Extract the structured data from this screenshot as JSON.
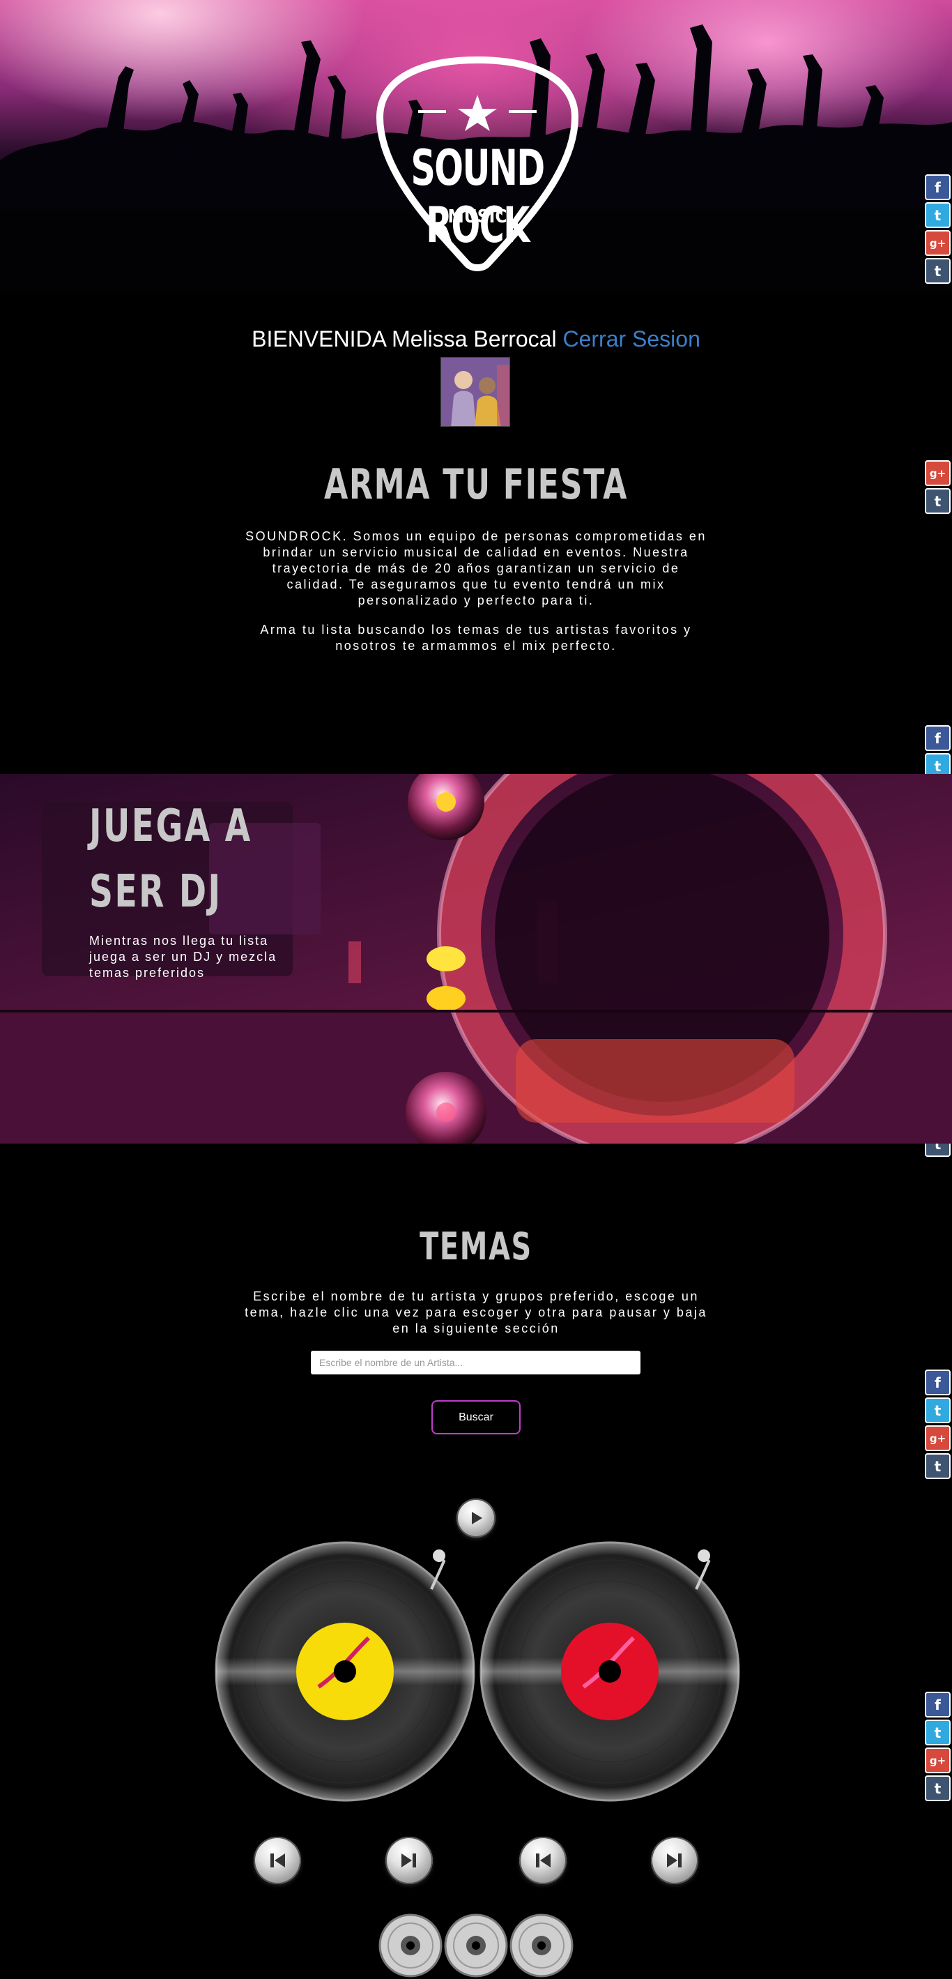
{
  "brand": {
    "name": "SOUND ROCK",
    "sub": "MUSIC"
  },
  "welcome": {
    "greeting": "BIENVENIDA Melissa Berrocal",
    "logout": "Cerrar Sesion"
  },
  "social": [
    "facebook-icon",
    "twitter-icon",
    "google-plus-icon",
    "tumblr-icon"
  ],
  "social_labels": {
    "facebook": "f",
    "twitter": "t",
    "google_plus": "g+",
    "tumblr": "t"
  },
  "party": {
    "title": "ARMA TU FIESTA",
    "p1": "SOUNDROCK. Somos un equipo de personas comprometidas en brindar un servicio musical de calidad en eventos. Nuestra trayectoria de más de 20 años garantizan un servicio de calidad. Te aseguramos que tu evento tendrá un mix personalizado y perfecto para ti.",
    "p2": "Arma tu lista buscando los temas de tus artistas favoritos y nosotros te armammos el mix perfecto."
  },
  "dj": {
    "title_line1": "JUEGA A",
    "title_line2": "SER DJ",
    "text": "Mientras nos llega tu lista juega a ser un DJ y mezcla temas preferidos"
  },
  "temas": {
    "title": "TEMAS",
    "text": "Escribe el nombre de tu artista y grupos preferido, escoge un tema, hazle clic una vez para escoger y otra para pausar y baja en la siguiente sección",
    "placeholder": "Escribe el nombre de un Artista...",
    "button": "Buscar"
  },
  "colors": {
    "accent": "#c13cc9",
    "link": "#3a7fc9",
    "label_left": "#f7dc0a",
    "label_right": "#e4102a"
  }
}
